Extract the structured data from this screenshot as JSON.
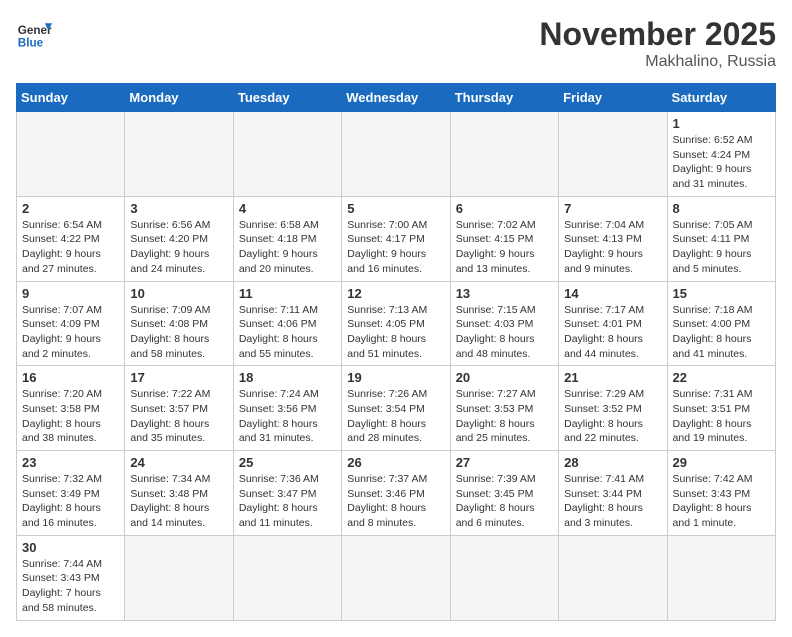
{
  "logo": {
    "text_general": "General",
    "text_blue": "Blue"
  },
  "header": {
    "month": "November 2025",
    "location": "Makhalino, Russia"
  },
  "weekdays": [
    "Sunday",
    "Monday",
    "Tuesday",
    "Wednesday",
    "Thursday",
    "Friday",
    "Saturday"
  ],
  "days": [
    {
      "num": "",
      "info": ""
    },
    {
      "num": "",
      "info": ""
    },
    {
      "num": "",
      "info": ""
    },
    {
      "num": "",
      "info": ""
    },
    {
      "num": "",
      "info": ""
    },
    {
      "num": "",
      "info": ""
    },
    {
      "num": "1",
      "info": "Sunrise: 6:52 AM\nSunset: 4:24 PM\nDaylight: 9 hours\nand 31 minutes."
    },
    {
      "num": "2",
      "info": "Sunrise: 6:54 AM\nSunset: 4:22 PM\nDaylight: 9 hours\nand 27 minutes."
    },
    {
      "num": "3",
      "info": "Sunrise: 6:56 AM\nSunset: 4:20 PM\nDaylight: 9 hours\nand 24 minutes."
    },
    {
      "num": "4",
      "info": "Sunrise: 6:58 AM\nSunset: 4:18 PM\nDaylight: 9 hours\nand 20 minutes."
    },
    {
      "num": "5",
      "info": "Sunrise: 7:00 AM\nSunset: 4:17 PM\nDaylight: 9 hours\nand 16 minutes."
    },
    {
      "num": "6",
      "info": "Sunrise: 7:02 AM\nSunset: 4:15 PM\nDaylight: 9 hours\nand 13 minutes."
    },
    {
      "num": "7",
      "info": "Sunrise: 7:04 AM\nSunset: 4:13 PM\nDaylight: 9 hours\nand 9 minutes."
    },
    {
      "num": "8",
      "info": "Sunrise: 7:05 AM\nSunset: 4:11 PM\nDaylight: 9 hours\nand 5 minutes."
    },
    {
      "num": "9",
      "info": "Sunrise: 7:07 AM\nSunset: 4:09 PM\nDaylight: 9 hours\nand 2 minutes."
    },
    {
      "num": "10",
      "info": "Sunrise: 7:09 AM\nSunset: 4:08 PM\nDaylight: 8 hours\nand 58 minutes."
    },
    {
      "num": "11",
      "info": "Sunrise: 7:11 AM\nSunset: 4:06 PM\nDaylight: 8 hours\nand 55 minutes."
    },
    {
      "num": "12",
      "info": "Sunrise: 7:13 AM\nSunset: 4:05 PM\nDaylight: 8 hours\nand 51 minutes."
    },
    {
      "num": "13",
      "info": "Sunrise: 7:15 AM\nSunset: 4:03 PM\nDaylight: 8 hours\nand 48 minutes."
    },
    {
      "num": "14",
      "info": "Sunrise: 7:17 AM\nSunset: 4:01 PM\nDaylight: 8 hours\nand 44 minutes."
    },
    {
      "num": "15",
      "info": "Sunrise: 7:18 AM\nSunset: 4:00 PM\nDaylight: 8 hours\nand 41 minutes."
    },
    {
      "num": "16",
      "info": "Sunrise: 7:20 AM\nSunset: 3:58 PM\nDaylight: 8 hours\nand 38 minutes."
    },
    {
      "num": "17",
      "info": "Sunrise: 7:22 AM\nSunset: 3:57 PM\nDaylight: 8 hours\nand 35 minutes."
    },
    {
      "num": "18",
      "info": "Sunrise: 7:24 AM\nSunset: 3:56 PM\nDaylight: 8 hours\nand 31 minutes."
    },
    {
      "num": "19",
      "info": "Sunrise: 7:26 AM\nSunset: 3:54 PM\nDaylight: 8 hours\nand 28 minutes."
    },
    {
      "num": "20",
      "info": "Sunrise: 7:27 AM\nSunset: 3:53 PM\nDaylight: 8 hours\nand 25 minutes."
    },
    {
      "num": "21",
      "info": "Sunrise: 7:29 AM\nSunset: 3:52 PM\nDaylight: 8 hours\nand 22 minutes."
    },
    {
      "num": "22",
      "info": "Sunrise: 7:31 AM\nSunset: 3:51 PM\nDaylight: 8 hours\nand 19 minutes."
    },
    {
      "num": "23",
      "info": "Sunrise: 7:32 AM\nSunset: 3:49 PM\nDaylight: 8 hours\nand 16 minutes."
    },
    {
      "num": "24",
      "info": "Sunrise: 7:34 AM\nSunset: 3:48 PM\nDaylight: 8 hours\nand 14 minutes."
    },
    {
      "num": "25",
      "info": "Sunrise: 7:36 AM\nSunset: 3:47 PM\nDaylight: 8 hours\nand 11 minutes."
    },
    {
      "num": "26",
      "info": "Sunrise: 7:37 AM\nSunset: 3:46 PM\nDaylight: 8 hours\nand 8 minutes."
    },
    {
      "num": "27",
      "info": "Sunrise: 7:39 AM\nSunset: 3:45 PM\nDaylight: 8 hours\nand 6 minutes."
    },
    {
      "num": "28",
      "info": "Sunrise: 7:41 AM\nSunset: 3:44 PM\nDaylight: 8 hours\nand 3 minutes."
    },
    {
      "num": "29",
      "info": "Sunrise: 7:42 AM\nSunset: 3:43 PM\nDaylight: 8 hours\nand 1 minute."
    },
    {
      "num": "30",
      "info": "Sunrise: 7:44 AM\nSunset: 3:43 PM\nDaylight: 7 hours\nand 58 minutes."
    },
    {
      "num": "",
      "info": ""
    },
    {
      "num": "",
      "info": ""
    },
    {
      "num": "",
      "info": ""
    },
    {
      "num": "",
      "info": ""
    },
    {
      "num": "",
      "info": ""
    },
    {
      "num": "",
      "info": ""
    }
  ]
}
